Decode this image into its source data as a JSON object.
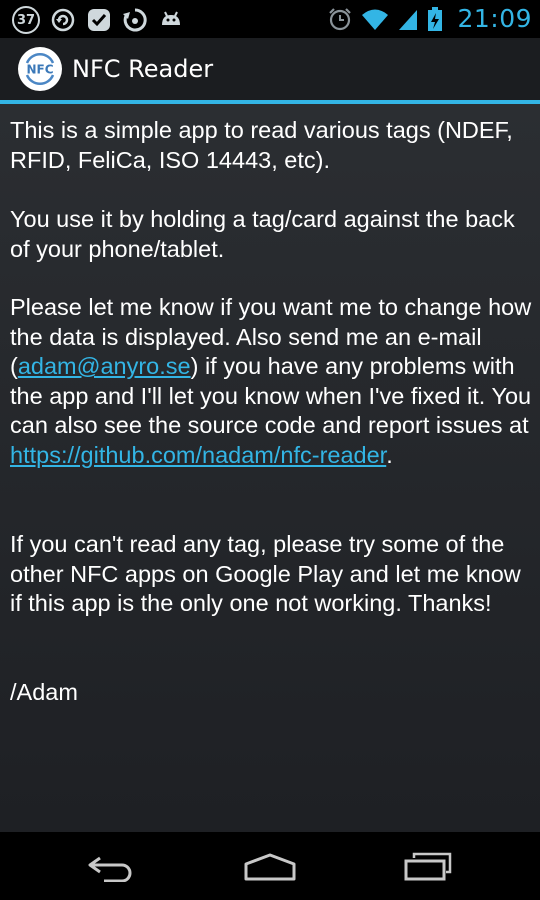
{
  "status_bar": {
    "notification_count": "37",
    "time": "21:09",
    "left_icons": [
      "notification-count-badge",
      "sync-icon",
      "check-icon",
      "recycle-icon",
      "android-icon"
    ],
    "right_icons": [
      "alarm-icon",
      "wifi-icon",
      "signal-icon",
      "battery-charging-icon"
    ]
  },
  "action_bar": {
    "logo_text": "NFC",
    "title": "NFC Reader"
  },
  "content": {
    "p1": "This is a simple app to read various tags (NDEF, RFID, FeliCa, ISO 14443, etc).",
    "p2": "You use it by holding a tag/card against the back of your phone/tablet.",
    "p3_before_email": "Please let me know if you want me to change how the data is displayed. Also send me an e-mail (",
    "email": "adam@anyro.se",
    "p3_after_email": ") if you have any problems with the app and I'll let you know when I've fixed it. You can also see the source code and report issues at ",
    "github_link": "https://github.com/nadam/nfc-reader",
    "p3_end": ".",
    "p4": "If you can't read any tag, please try some of the other NFC apps on Google Play and let me know if this app is the only one not working. Thanks!",
    "signature": "/Adam"
  },
  "nav_bar": {
    "buttons": [
      "back-button",
      "home-button",
      "recent-apps-button"
    ]
  },
  "colors": {
    "accent": "#33b5e5",
    "action_bar_bg": "#1b1d20",
    "content_bg_top": "#2b2e32"
  }
}
